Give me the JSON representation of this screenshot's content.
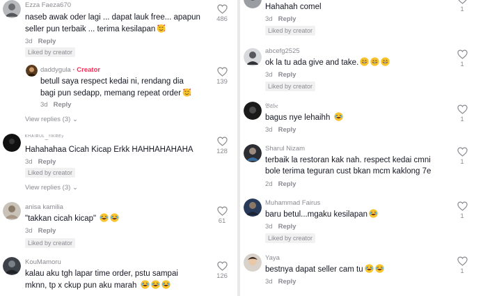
{
  "left": {
    "comments": [
      {
        "username": "Ezza Faeza670",
        "text": [
          "naseb awak oder lagi ... dapat lauk free... apapun",
          "seller pun terbaik ... terima kesilapan"
        ],
        "emoji": [
          "smiling-hearts"
        ],
        "time": "3d",
        "reply": "Reply",
        "likes": "486",
        "badge": "Liked by creator"
      },
      {
        "username": "daddygula",
        "creator_tag": "· Creator",
        "text": [
          "betull saya respect kedai ni, rendang dia",
          "bagi pun sedapp, memang repeat order"
        ],
        "emoji": [
          "smiling-hearts"
        ],
        "time": "3d",
        "reply": "Reply",
        "likes": "139"
      },
      {
        "view_replies": "View replies (3)"
      },
      {
        "username": "ᴷᴴᴬᴵᴿᵁᴸ_ᶠᴵᴷᴿᴱʸ",
        "text": [
          "Hahahahaa Cicah Kicap Erkk HAHHAHAHAHA"
        ],
        "time": "3d",
        "reply": "Reply",
        "likes": "128",
        "badge": "Liked by creator"
      },
      {
        "view_replies": "View replies (3)"
      },
      {
        "username": "anisa kamilia",
        "text": [
          "\"takkan cicah kicap\""
        ],
        "emoji": [
          "laughing",
          "laughing"
        ],
        "time": "3d",
        "reply": "Reply",
        "likes": "61",
        "badge": "Liked by creator"
      },
      {
        "username": "KouMamoru",
        "text": [
          "kalau aku tgh lapar time order, pstu sampai",
          "mknn, tp x ckup pun aku marah"
        ],
        "emoji": [
          "laughing",
          "laughing",
          "laughing"
        ],
        "likes": "126"
      }
    ]
  },
  "right": {
    "comments": [
      {
        "text": [
          "Hahahah comel"
        ],
        "time": "3d",
        "reply": "Reply",
        "likes": "1",
        "badge": "Liked by creator"
      },
      {
        "username": "abcefg2525",
        "text": [
          "ok la tu ada give and take."
        ],
        "emoji": [
          "grin",
          "grin",
          "grin"
        ],
        "time": "3d",
        "reply": "Reply",
        "likes": "1",
        "badge": "Liked by creator"
      },
      {
        "username": "𝔅𝔞𝔟𝔢",
        "text": [
          "bagus nye lehaihh"
        ],
        "emoji": [
          "laughing"
        ],
        "time": "3d",
        "reply": "Reply",
        "likes": "1"
      },
      {
        "username": "Sharul Nizam",
        "text": [
          "terbaik la restoran kak nah. respect kedai cmni",
          "bole terima teguran cust bkan mcm kaklong 7e"
        ],
        "time": "2d",
        "reply": "Reply",
        "likes": "1"
      },
      {
        "username": "Muhammad Fairus",
        "text": [
          "baru betul...mgaku kesilapan"
        ],
        "emoji": [
          "laughing"
        ],
        "time": "3d",
        "reply": "Reply",
        "likes": "1",
        "badge": "Liked by creator"
      },
      {
        "username": "Yaya",
        "text": [
          "bestnya dapat seller cam tu"
        ],
        "emoji": [
          "laughing",
          "laughing"
        ],
        "time": "3d",
        "reply": "Reply",
        "likes": "1"
      }
    ]
  }
}
